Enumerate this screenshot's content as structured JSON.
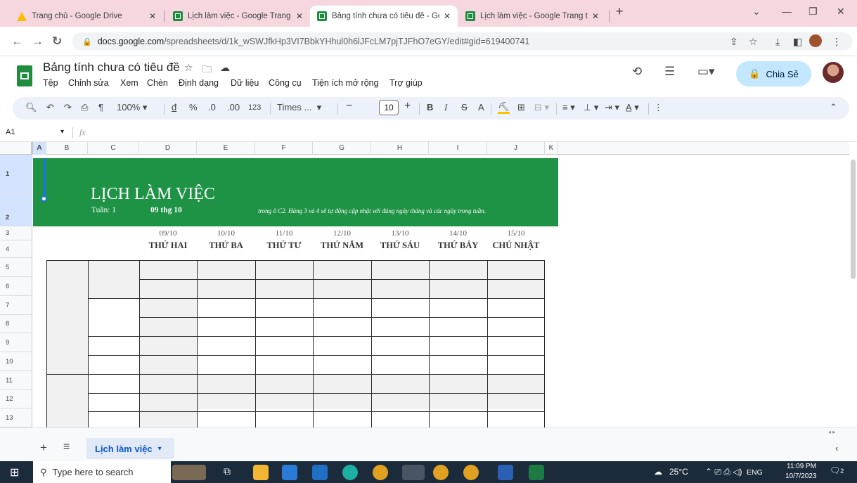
{
  "browser": {
    "tabs": [
      {
        "title": "Trang chủ - Google Drive",
        "icon": "drive-icon"
      },
      {
        "title": "Lịch làm việc - Google Trang tính",
        "icon": "sheets-icon"
      },
      {
        "title": "Bảng tính chưa có tiêu đề - Goo",
        "icon": "sheets-icon",
        "active": true
      },
      {
        "title": "Lịch làm việc - Google Trang tính",
        "icon": "sheets-icon"
      }
    ],
    "url_host": "docs.google.com",
    "url_path": "/spreadsheets/d/1k_wSWJfkHp3VI7BbkYHhul0h6lJFcLM7pjTJFhO7eGY/edit#gid=619400741"
  },
  "doc": {
    "title": "Bảng tính chưa có tiêu đề",
    "menus": [
      "Tệp",
      "Chỉnh sửa",
      "Xem",
      "Chèn",
      "Định dạng",
      "Dữ liệu",
      "Công cụ",
      "Tiện ích mở rộng",
      "Trợ giúp"
    ],
    "share_label": "Chia Sẻ"
  },
  "toolbar": {
    "zoom": "100%",
    "currency": "đ",
    "percent": "%",
    "dec_less": ".0",
    "dec_more": ".00",
    "number_format": "123",
    "font": "Times ...",
    "font_size": "10",
    "bold": "B",
    "italic": "I",
    "strike": "S",
    "text_color": "A"
  },
  "formula_bar": {
    "cell_ref": "A1",
    "fx": "fx"
  },
  "grid": {
    "columns": [
      "A",
      "B",
      "C",
      "D",
      "E",
      "F",
      "G",
      "H",
      "I",
      "J",
      "K"
    ],
    "rows": [
      "1",
      "2",
      "3",
      "4",
      "5",
      "6",
      "7",
      "8",
      "9",
      "10",
      "11",
      "12",
      "13"
    ]
  },
  "schedule": {
    "title": "LỊCH LÀM VIỆC",
    "week_label": "Tuần: 1",
    "week_value": "09 thg 10",
    "note": "trong ô C2. Hàng 3 và 4 sẽ tự động cập nhật với đúng ngày tháng và các ngày trong tuần.",
    "days": [
      {
        "date": "09/10",
        "name": "THỨ HAI"
      },
      {
        "date": "10/10",
        "name": "THỨ BA"
      },
      {
        "date": "11/10",
        "name": "THỨ TƯ"
      },
      {
        "date": "12/10",
        "name": "THỨ NĂM"
      },
      {
        "date": "13/10",
        "name": "THỨ SÁU"
      },
      {
        "date": "14/10",
        "name": "THỨ BẢY"
      },
      {
        "date": "15/10",
        "name": "CHỦ NHẬT"
      }
    ]
  },
  "sheet_tabs": {
    "active": "Lịch làm việc"
  },
  "taskbar": {
    "search_placeholder": "Type here to search",
    "weather": "25°C",
    "lang": "ENG",
    "time": "11:09 PM",
    "date": "10/7/2023",
    "notifications": "2"
  }
}
